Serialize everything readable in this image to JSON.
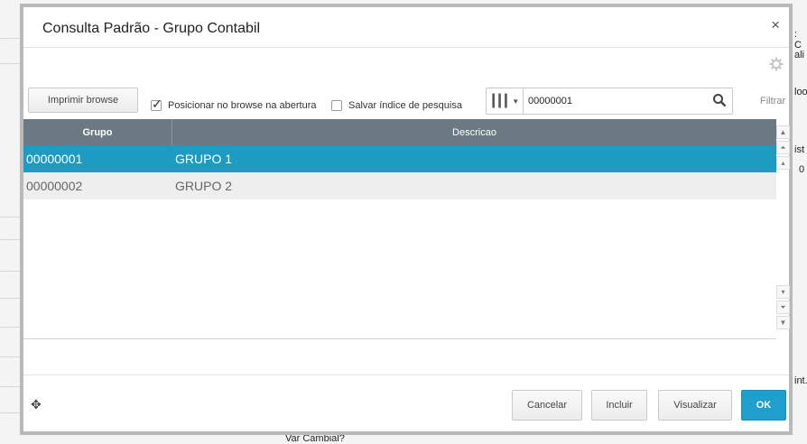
{
  "background": {
    "label_c": ": C",
    "label_ali": "ali",
    "label_ploo": "loo",
    "label_ist": "ist",
    "label_0": "0",
    "label_int": "int.",
    "label_var": "Var Cambial?"
  },
  "dialog": {
    "title": "Consulta Padrão - Grupo Contabil",
    "close_label": "×"
  },
  "toolbar": {
    "print_label": "Imprimir browse",
    "position_label": "Posicionar no browse na abertura",
    "position_checked": true,
    "save_index_label": "Salvar índice de pesquisa",
    "save_index_checked": false,
    "search_value": "00000001",
    "filter_label": "Filtrar"
  },
  "grid": {
    "columns": [
      "Grupo",
      "Descricao"
    ],
    "rows": [
      {
        "grupo": "00000001",
        "descricao": "GRUPO 1",
        "selected": true
      },
      {
        "grupo": "00000002",
        "descricao": "GRUPO 2",
        "selected": false
      }
    ]
  },
  "footer": {
    "cancel_label": "Cancelar",
    "include_label": "Incluir",
    "view_label": "Visualizar",
    "ok_label": "OK"
  },
  "colors": {
    "header": "#6b7a82",
    "selected_row": "#1d9bc0",
    "ok_button": "#1f9fce"
  }
}
